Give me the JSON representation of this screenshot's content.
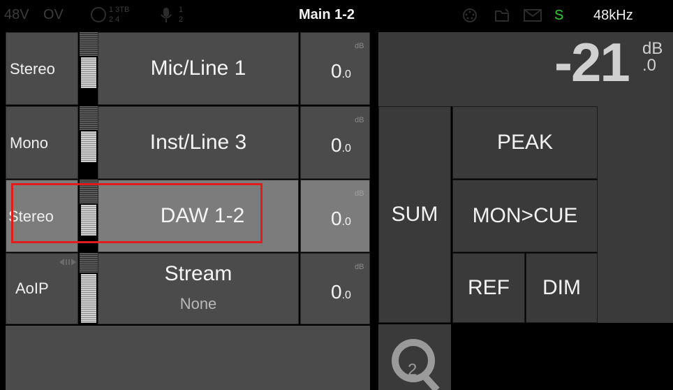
{
  "status_bar": {
    "phantom": "48V",
    "overvoltage": "OV",
    "input_grid_top": "1 3TB",
    "input_grid_bottom": "2 4",
    "mic_top": "1",
    "mic_bottom": "2",
    "title": "Main 1-2",
    "s_indicator": "S",
    "sample_rate": "48kHz"
  },
  "channels": [
    {
      "format": "Stereo",
      "name": "Mic/Line 1",
      "sub": "",
      "gain_main": "0",
      "gain_dec": ".0",
      "unit": "dB"
    },
    {
      "format": "Mono",
      "name": "Inst/Line 3",
      "sub": "",
      "gain_main": "0",
      "gain_dec": ".0",
      "unit": "dB"
    },
    {
      "format": "Stereo",
      "name": "DAW 1-2",
      "sub": "",
      "gain_main": "0",
      "gain_dec": ".0",
      "unit": "dB"
    },
    {
      "format": "AoIP",
      "name": "Stream",
      "sub": "None",
      "gain_main": "0",
      "gain_dec": ".0",
      "unit": "dB"
    }
  ],
  "monitor": {
    "level_main": "-21",
    "level_unit": "dB",
    "level_dec": ".0",
    "sum_label": "SUM",
    "peak_label": "PEAK",
    "mon_cue_label": "MON>CUE",
    "ref_label": "REF",
    "dim_label": "DIM",
    "logo_number": "2"
  },
  "colors": {
    "accent_green": "#2fd12f",
    "selection_outline": "#e21b1b"
  }
}
